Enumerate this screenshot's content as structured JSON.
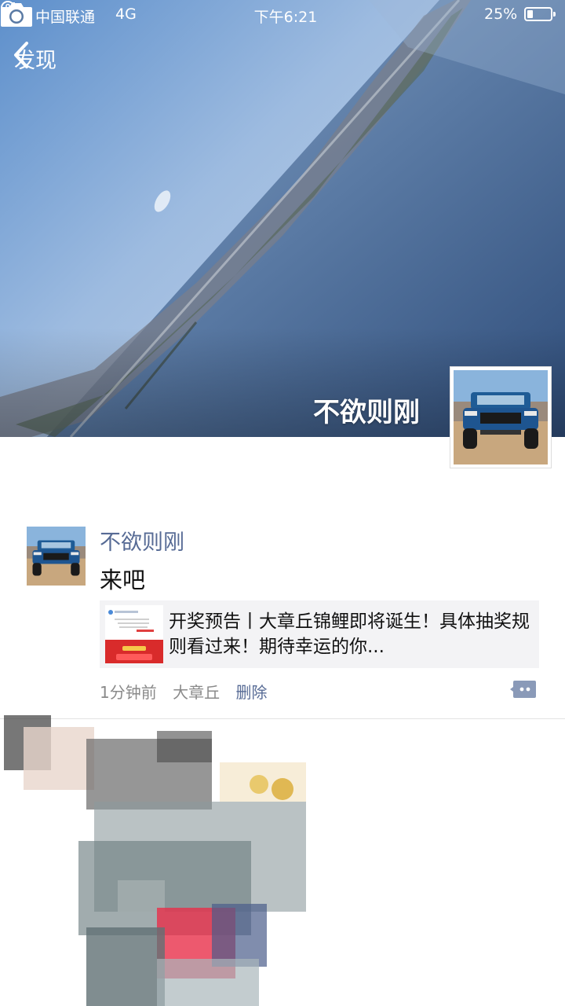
{
  "status_bar": {
    "carrier": "中国联通",
    "network": "4G",
    "time": "下午6:21",
    "battery_percent": "25%",
    "battery_level": 0.25
  },
  "nav": {
    "back_label": "发现",
    "back_icon": "chevron-left-icon",
    "camera_icon": "camera-icon"
  },
  "cover": {
    "user_name": "不欲则刚"
  },
  "post": {
    "author": "不欲则刚",
    "text": "来吧",
    "link": {
      "title": "开奖预告丨大章丘锦鲤即将诞生！具体抽奖规则看过来！期待幸运的你..."
    },
    "time": "1分钟前",
    "location": "大章丘",
    "delete_label": "删除",
    "comment_icon": "comment-icon"
  },
  "colors": {
    "link_blue": "#576b95",
    "card_bg": "#f3f3f5",
    "meta_gray": "#8a8a8a"
  }
}
